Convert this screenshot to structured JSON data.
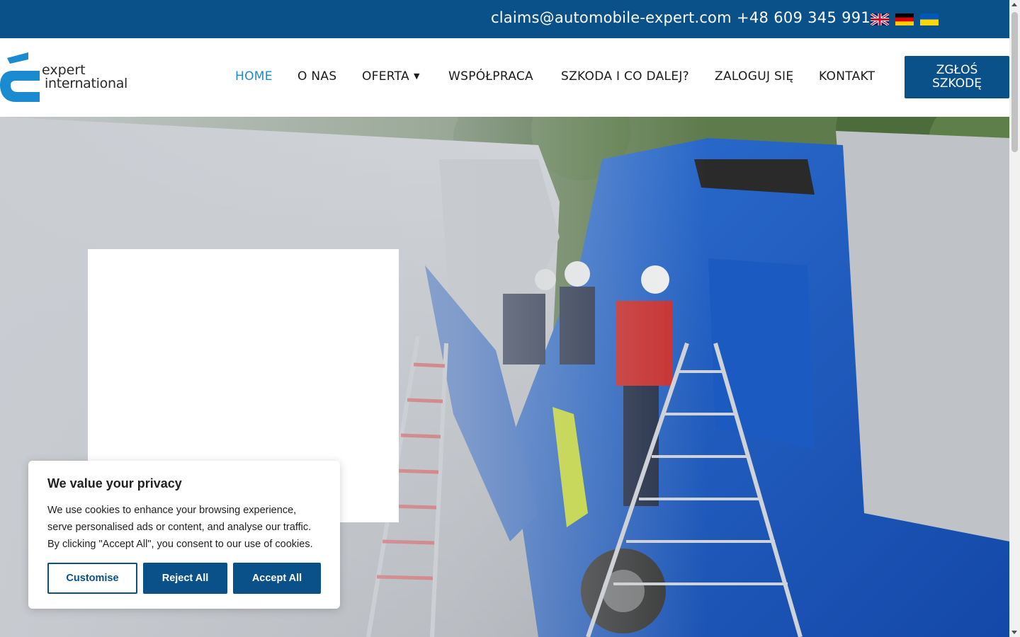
{
  "topbar": {
    "email": "claims@automobile-expert.com",
    "phone": "+48 609 345 991",
    "languages": [
      "English",
      "Deutsch",
      "Українська"
    ]
  },
  "logo": {
    "line1": "expert",
    "line2": "international"
  },
  "nav": {
    "items": [
      {
        "label": "HOME",
        "active": true
      },
      {
        "label": "O NAS"
      },
      {
        "label": "OFERTA",
        "dropdown": true
      },
      {
        "label": "WSPÓŁPRACA"
      },
      {
        "label": "SZKODA I CO DALEJ?"
      },
      {
        "label": "ZALOGUJ SIĘ"
      },
      {
        "label": "KONTAKT"
      }
    ],
    "cta_line1": "ZGŁOŚ",
    "cta_line2": "SZKODĘ"
  },
  "cookie": {
    "title": "We value your privacy",
    "text": "We use cookies to enhance your browsing experience, serve personalised ads or content, and analyse our traffic. By clicking \"Accept All\", you consent to our use of cookies.",
    "customise": "Customise",
    "reject": "Reject All",
    "accept": "Accept All"
  },
  "colors": {
    "brand_blue": "#0b5189",
    "accent_blue": "#1a8ad1"
  }
}
